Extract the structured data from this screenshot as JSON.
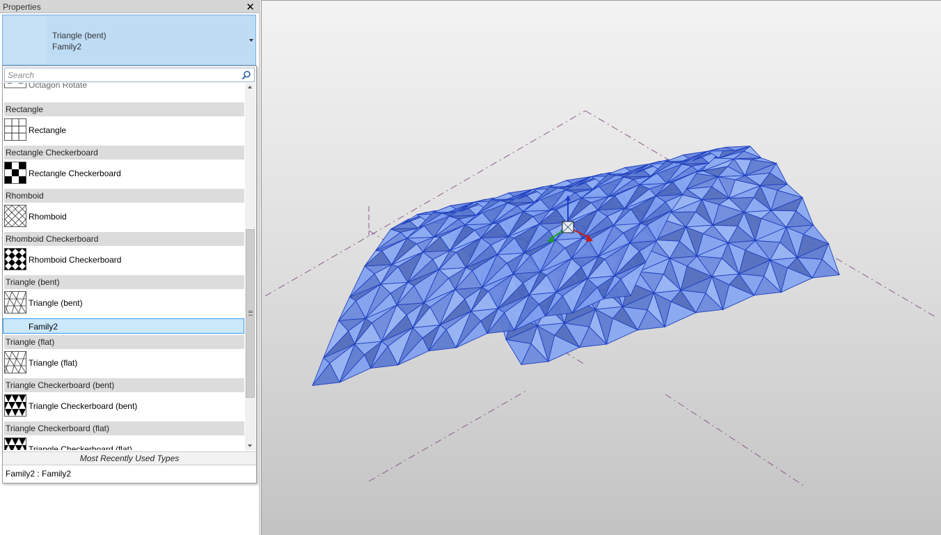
{
  "panel": {
    "title": "Properties",
    "type_selector": {
      "line1": "Triangle (bent)",
      "line2": "Family2"
    }
  },
  "search": {
    "placeholder": "Search"
  },
  "partial_item": {
    "label": "Octagon Rotate"
  },
  "groups": [
    {
      "header": "Rectangle",
      "items": [
        {
          "label": "Rectangle",
          "icon": "grid-pattern-icon"
        }
      ]
    },
    {
      "header": "Rectangle Checkerboard",
      "items": [
        {
          "label": "Rectangle Checkerboard",
          "icon": "checkerboard-pattern-icon"
        }
      ]
    },
    {
      "header": "Rhomboid",
      "items": [
        {
          "label": "Rhomboid",
          "icon": "rhomboid-pattern-icon"
        }
      ]
    },
    {
      "header": "Rhomboid Checkerboard",
      "items": [
        {
          "label": "Rhomboid Checkerboard",
          "icon": "rhomboid-checkerboard-pattern-icon"
        }
      ]
    },
    {
      "header": "Triangle (bent)",
      "items": [
        {
          "label": "Triangle (bent)",
          "icon": "triangle-pattern-icon"
        },
        {
          "label": "Family2",
          "selected": true
        }
      ]
    },
    {
      "header": "Triangle (flat)",
      "items": [
        {
          "label": "Triangle (flat)",
          "icon": "triangle-pattern-icon"
        }
      ]
    },
    {
      "header": "Triangle Checkerboard (bent)",
      "items": [
        {
          "label": "Triangle Checkerboard (bent)",
          "icon": "triangle-checkerboard-pattern-icon"
        }
      ]
    },
    {
      "header": "Triangle Checkerboard (flat)",
      "items": [
        {
          "label": "Triangle Checkerboard (flat)",
          "icon": "triangle-checkerboard-pattern-icon"
        }
      ]
    }
  ],
  "mru": {
    "header": "Most Recently Used Types",
    "item": "Family2 : Family2"
  },
  "colors": {
    "selection": "#cce8fb",
    "selection_border": "#3399ff",
    "surface": "#7b9be8",
    "edge": "#1e3fbf"
  }
}
